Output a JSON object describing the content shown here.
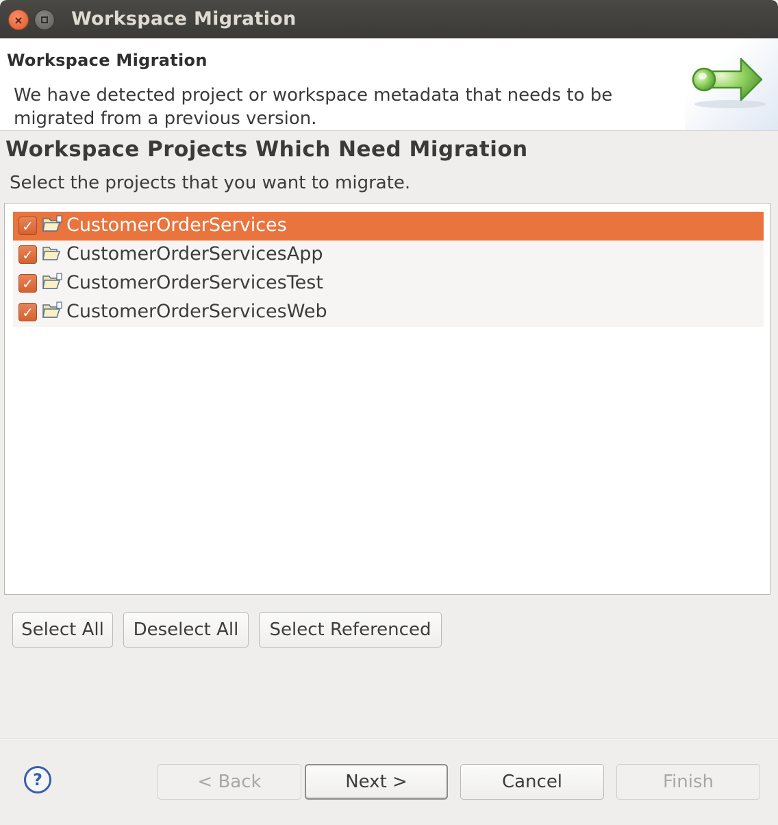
{
  "window": {
    "title": "Workspace Migration",
    "close_glyph": "×"
  },
  "banner": {
    "title": "Workspace Migration",
    "description": "We have detected project or workspace metadata that needs to be migrated from a previous version.",
    "icon": "migration-arrow-icon",
    "icon_color": "#6cc24a"
  },
  "section": {
    "title": "Workspace Projects Which Need Migration",
    "description": "Select the projects that you want to migrate."
  },
  "projects": [
    {
      "label": "CustomerOrderServices",
      "checked": true,
      "selected": true
    },
    {
      "label": "CustomerOrderServicesApp",
      "checked": true,
      "selected": false
    },
    {
      "label": "CustomerOrderServicesTest",
      "checked": true,
      "selected": false
    },
    {
      "label": "CustomerOrderServicesWeb",
      "checked": true,
      "selected": false
    }
  ],
  "selection_buttons": {
    "select_all": "Select All",
    "deselect_all": "Deselect All",
    "select_referenced": "Select Referenced"
  },
  "footer": {
    "help_glyph": "?",
    "back": "< Back",
    "next": "Next >",
    "cancel": "Cancel",
    "finish": "Finish"
  },
  "colors": {
    "accent": "#e9743d",
    "checkbox": "#d4622f",
    "help": "#3a5fa8"
  }
}
